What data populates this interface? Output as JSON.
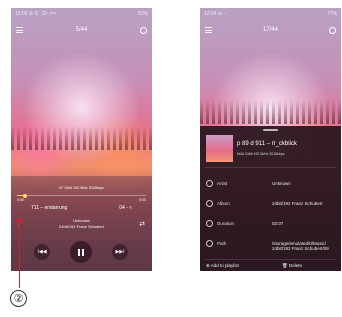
{
  "screen1": {
    "status_left": "12:02 ⊘ R · D¹ ¹¹ᵒᵒ",
    "status_right": "82%",
    "title": "5/44",
    "codec_info": "M° 24bit 192.0kHz 3018kbps",
    "time_elapsed": "0:00",
    "time_total": "0:00",
    "track_title": "711 – erstarrung",
    "track_title_right": "04 - ≈",
    "artist": "Unknown",
    "album": "24bit/192 Franz Schubert",
    "progress": 0.06,
    "prev_label": "I◀◀",
    "next_label": "▶▶I"
  },
  "screen2": {
    "status_left": "12:04 ⊘ ◦ ·",
    "status_right": "77%",
    "title": "17/44",
    "detail_title": "p 89 d 911 – rr_ckblick",
    "detail_codec": "M4A  24bit  192.0kHz  3018kbps",
    "rows": [
      {
        "label": "Artist",
        "value": "Unknown"
      },
      {
        "label": "Album",
        "value": "24bit/192 Franz Schubert"
      },
      {
        "label": "Duration",
        "value": "02:07"
      },
      {
        "label": "Path",
        "value": "/storage/emulated/0/Music/ 24bit/192 Franz Schubert/09"
      }
    ],
    "add_to_playlist": "Add to playlist",
    "delete": "Delete"
  },
  "callout": {
    "number": "②"
  },
  "colors": {
    "accent": "#ffd66b",
    "callout": "#d21e2c"
  }
}
